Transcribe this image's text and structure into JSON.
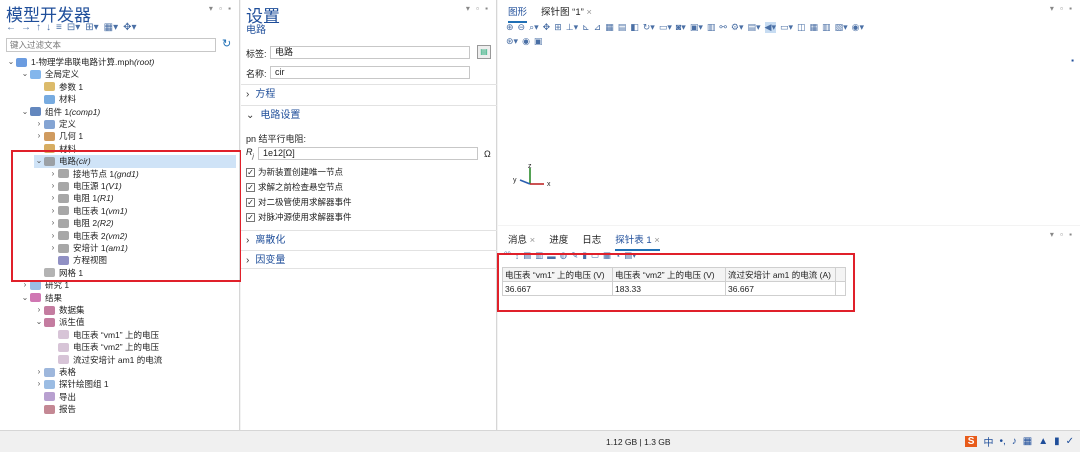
{
  "model_builder": {
    "title": "模型开发器",
    "search_placeholder": "键入过滤文本",
    "tree": [
      {
        "label": "1-物理学串联电路计算.mph",
        "tag": "(root)",
        "level": 0,
        "expanded": true
      },
      {
        "label": "全局定义",
        "level": 1,
        "expanded": true
      },
      {
        "label": "参数 1",
        "level": 2
      },
      {
        "label": "材料",
        "level": 2
      },
      {
        "label": "组件 1",
        "tag": "(comp1)",
        "level": 1,
        "expanded": true
      },
      {
        "label": "定义",
        "level": 2,
        "collapsed": true
      },
      {
        "label": "几何 1",
        "level": 2,
        "collapsed": true
      },
      {
        "label": "材料",
        "level": 2
      },
      {
        "label": "电路",
        "tag": "(cir)",
        "level": 2,
        "expanded": true,
        "selected": true
      },
      {
        "label": "接地节点 1",
        "tag": "(gnd1)",
        "level": 3,
        "collapsed": true
      },
      {
        "label": "电压源 1",
        "tag": "(V1)",
        "level": 3,
        "collapsed": true
      },
      {
        "label": "电阻 1",
        "tag": "(R1)",
        "level": 3,
        "collapsed": true
      },
      {
        "label": "电压表 1",
        "tag": "(vm1)",
        "level": 3,
        "collapsed": true
      },
      {
        "label": "电阻 2",
        "tag": "(R2)",
        "level": 3,
        "collapsed": true
      },
      {
        "label": "电压表 2",
        "tag": "(vm2)",
        "level": 3,
        "collapsed": true
      },
      {
        "label": "安培计 1",
        "tag": "(am1)",
        "level": 3,
        "collapsed": true
      },
      {
        "label": "方程视图",
        "level": 3
      },
      {
        "label": "网格 1",
        "level": 2
      },
      {
        "label": "研究 1",
        "level": 1,
        "collapsed": true
      },
      {
        "label": "结果",
        "level": 1,
        "expanded": true
      },
      {
        "label": "数据集",
        "level": 2,
        "collapsed": true
      },
      {
        "label": "派生值",
        "level": 2,
        "expanded": true
      },
      {
        "label": "电压表 “vm1” 上的电压",
        "level": 3
      },
      {
        "label": "电压表 “vm2” 上的电压",
        "level": 3
      },
      {
        "label": "流过安培计 am1 的电流",
        "level": 3
      },
      {
        "label": "表格",
        "level": 2,
        "collapsed": true
      },
      {
        "label": "探针绘图组 1",
        "level": 2,
        "collapsed": true
      },
      {
        "label": "导出",
        "level": 2
      },
      {
        "label": "报告",
        "level": 2
      }
    ]
  },
  "settings": {
    "title": "设置",
    "subtitle": "电路",
    "label_caption": "标签:",
    "label_value": "电路",
    "name_caption": "名称:",
    "name_value": "cir",
    "sections": {
      "equation": "方程",
      "circuit_settings": "电路设置",
      "discretization": "离散化",
      "dependent_vars": "因变量"
    },
    "pn_label": "pn 结平行电阻:",
    "r_symbol": "R",
    "r_subscript": "j",
    "r_value": "1e12[Ω]",
    "r_unit": "Ω",
    "checkboxes": [
      {
        "label": "为新装置创建唯一节点",
        "checked": true
      },
      {
        "label": "求解之前检查悬空节点",
        "checked": true
      },
      {
        "label": "对二极管使用求解器事件",
        "checked": true
      },
      {
        "label": "对脉冲源使用求解器事件",
        "checked": true
      }
    ]
  },
  "graphics": {
    "tabs": [
      "图形",
      "探针图 “1”"
    ],
    "axis_labels": {
      "x": "x",
      "y": "y",
      "z": "z"
    }
  },
  "output": {
    "tabs": [
      "消息",
      "进度",
      "日志",
      "探针表 1"
    ],
    "table": {
      "headers": [
        "电压表 “vm1” 上的电压 (V)",
        "电压表 “vm2” 上的电压 (V)",
        "流过安培计 am1 的电流 (A)"
      ],
      "rows": [
        [
          "36.667",
          "183.33",
          "36.667"
        ]
      ]
    }
  },
  "status": {
    "memory": "1.12 GB | 1.3 GB",
    "ime_label": "中"
  },
  "colors": {
    "accent": "#1f4e9a",
    "highlight": "#e0202a",
    "selection": "#cfe3f7"
  }
}
